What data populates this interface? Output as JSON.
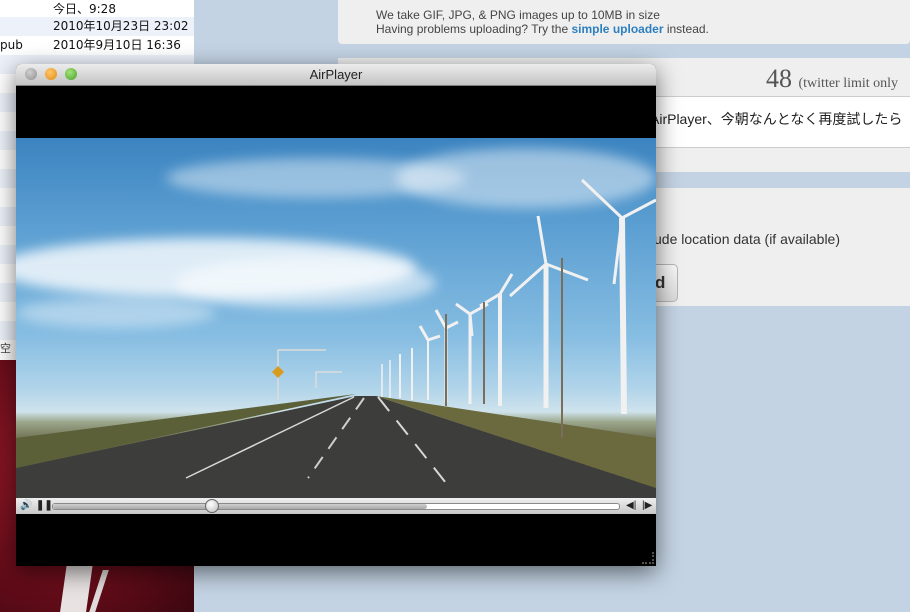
{
  "finder": {
    "rows": [
      {
        "name": "",
        "date": "今日、9:28"
      },
      {
        "name": "",
        "date": "2010年10月23日 23:02"
      },
      {
        "name": "pub",
        "date": "2010年9月10日 16:36"
      }
    ],
    "search_fragment": "空"
  },
  "upload": {
    "info_line": "We take GIF, JPG, & PNG images up to 10MB in size",
    "problem_text": "Having problems uploading? Try the",
    "link_text": "simple uploader",
    "suffix": "instead."
  },
  "tweet": {
    "counter": "48",
    "counter_note": "(twitter limit only",
    "text": "AirPlayer、今朝なんとなく再度試したら"
  },
  "location": {
    "label": "ude location data (if available)"
  },
  "submit": {
    "label": "d"
  },
  "player": {
    "title": "AirPlayer",
    "progress_fraction": 0.28,
    "buffered_fraction": 0.66
  },
  "colors": {
    "link": "#2c7fc0",
    "panel_bg": "#efefef",
    "page_bg": "#c3d3e3"
  }
}
